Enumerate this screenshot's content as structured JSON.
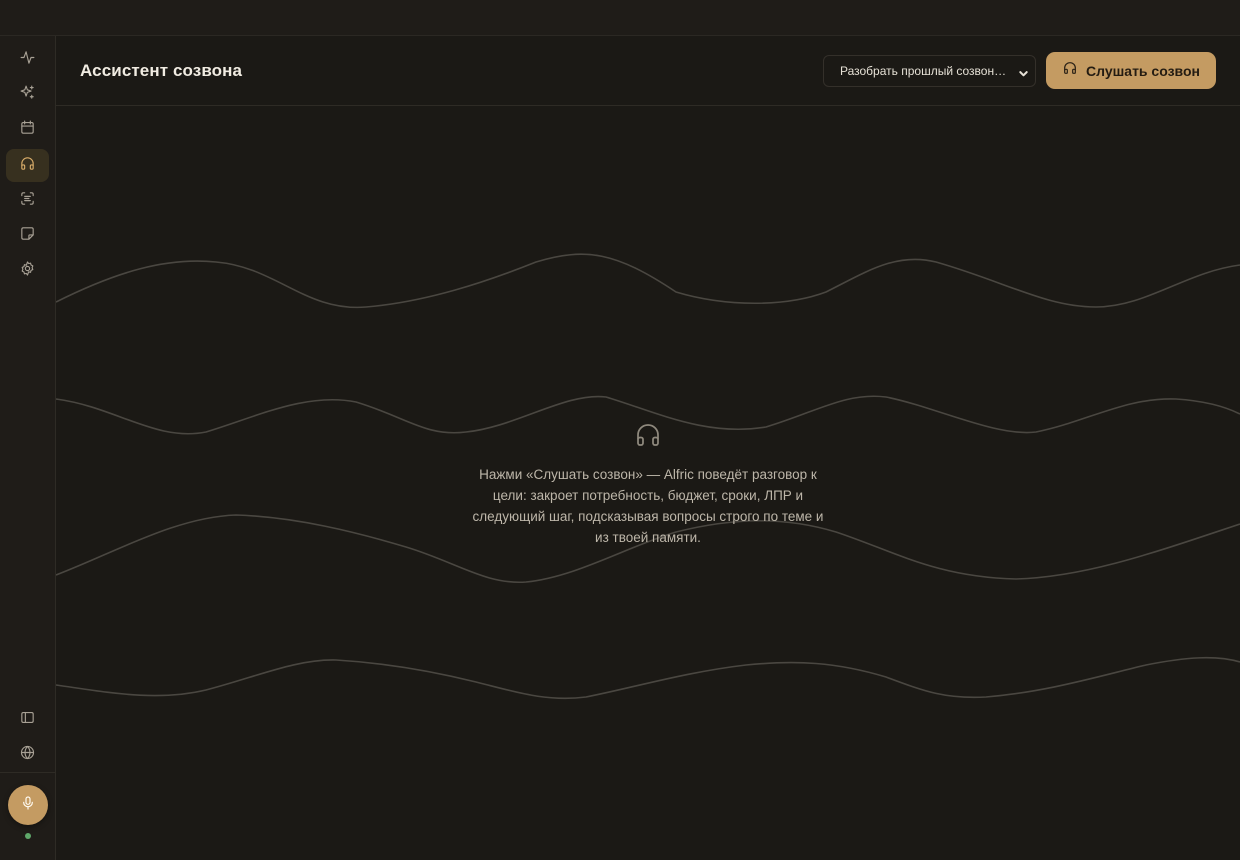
{
  "app": {
    "page_title": "Ассистент созвона"
  },
  "header": {
    "select_value": "Разобрать прошлый созвон…",
    "listen_button_label": "Слушать созвон"
  },
  "empty_state": {
    "icon": "headphones-icon",
    "text": "Нажми «Слушать созвон» — Alfric поведёт разговор к цели: закроет потребность, бюджет, сроки, ЛПР и следующий шаг, подсказывая вопросы строго по теме и из твоей памяти."
  },
  "sidebar": {
    "items": [
      {
        "icon": "activity-icon",
        "active": false
      },
      {
        "icon": "sparkles-icon",
        "active": false
      },
      {
        "icon": "calendar-icon",
        "active": false
      },
      {
        "icon": "headphones-icon",
        "active": true
      },
      {
        "icon": "scan-text-icon",
        "active": false
      },
      {
        "icon": "note-icon",
        "active": false
      },
      {
        "icon": "settings-gear-icon",
        "active": false
      }
    ],
    "bottom_items": [
      {
        "icon": "panel-toggle-icon"
      },
      {
        "icon": "globe-icon"
      }
    ],
    "mic_icon": "microphone-icon",
    "status": "online"
  },
  "colors": {
    "background": "#1b1915",
    "accent": "#c49b62",
    "active_icon": "#d9ad6a",
    "status_online": "#5fa86a"
  }
}
